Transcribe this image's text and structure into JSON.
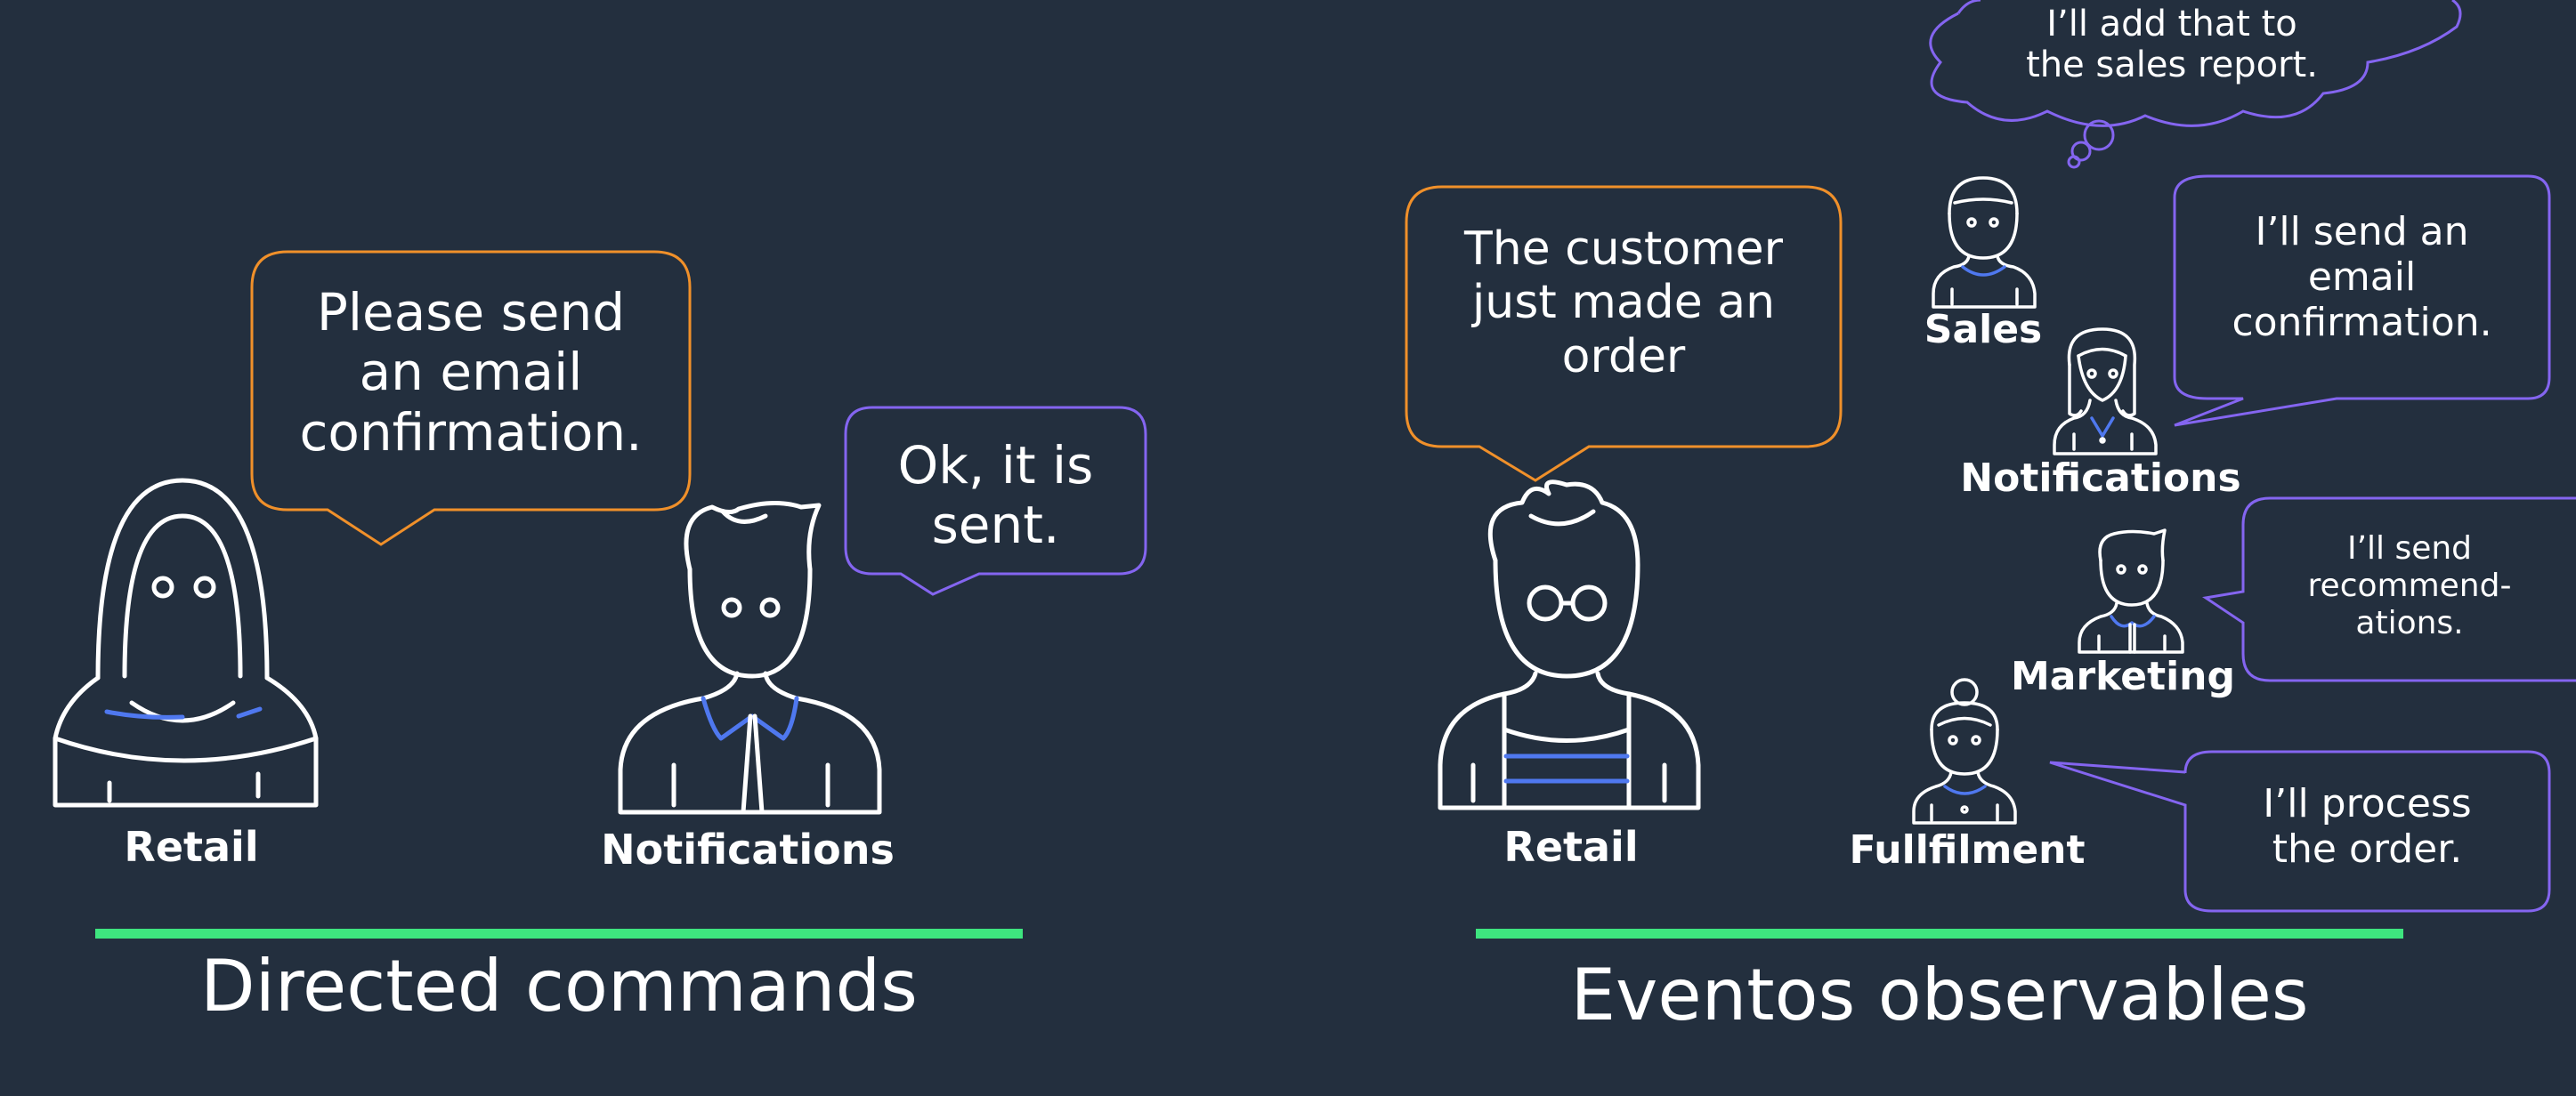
{
  "colors": {
    "background": "#232f3e",
    "accent_green": "#3ee57f",
    "bubble_orange": "#f0902a",
    "bubble_purple": "#8465f0",
    "figure_line": "#ffffff",
    "detail_blue": "#4f78ef"
  },
  "left": {
    "title": "Directed commands",
    "retail_bubble": [
      "Please send",
      "an email",
      "confirmation."
    ],
    "notif_bubble": [
      "Ok, it is",
      "sent."
    ],
    "retail_label": "Retail",
    "notif_label": "Notifications"
  },
  "right": {
    "title": "Eventos observables",
    "retail_bubble": [
      "The customer",
      "just made an",
      "order"
    ],
    "thought_bubble": [
      "I’ll add that to",
      "the sales report."
    ],
    "notif_bubble": [
      "I’ll send an",
      "email",
      "confirmation."
    ],
    "marketing_bubble": [
      "I’ll send",
      "recommend-",
      "ations."
    ],
    "fulfil_bubble": [
      "I’ll process",
      "the order."
    ],
    "retail_label": "Retail",
    "sales_label": "Sales",
    "notif_label": "Notifications",
    "marketing_label": "Marketing",
    "fulfil_label": "Fullfilment"
  }
}
